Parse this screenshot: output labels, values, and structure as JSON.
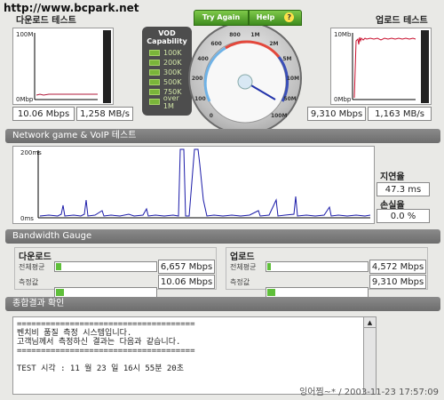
{
  "watermark_top": "http://www.bcpark.net",
  "download": {
    "title": "다운로드 테스트",
    "y_max": "100M",
    "y_min": "0Mbp",
    "speed_mbps": "10.06 Mbps",
    "speed_mbs": "1,258 MB/s"
  },
  "upload": {
    "title": "업로드 테스트",
    "y_max": "10Mb",
    "y_min": "0Mbp",
    "speed_mbps": "9,310 Mbps",
    "speed_mbs": "1,163 MB/s"
  },
  "vod": {
    "title": "VOD\nCapability",
    "items": [
      "100K",
      "200K",
      "300K",
      "500K",
      "750K",
      "over 1M"
    ]
  },
  "gauge": {
    "try_again": "Try Again",
    "help": "Help",
    "help_icon": "?",
    "ticks": [
      "0",
      "100",
      "200",
      "400",
      "600",
      "800",
      "1M",
      "2M",
      "5M",
      "10M",
      "50M",
      "100M"
    ]
  },
  "network": {
    "title": "Network game & VoIP 테스트",
    "y_max": "200ms",
    "y_min": "0ms",
    "latency_label": "지연율",
    "latency_value": "47.3 ms",
    "loss_label": "손실율",
    "loss_value": "0.0 %"
  },
  "bandwidth": {
    "title": "Bandwidth Gauge",
    "download_label": "다운로드",
    "upload_label": "업로드",
    "avg_label": "전체평균",
    "measured_label": "측정값",
    "dl_avg_value": "6,657 Mbps",
    "dl_measured_value": "10.06 Mbps",
    "ul_avg_value": "4,572 Mbps",
    "ul_measured_value": "9,310 Mbps",
    "dl_avg_fill": 0.07,
    "dl_measured_fill": 0.1,
    "ul_avg_fill": 0.05,
    "ul_measured_fill": 0.1
  },
  "summary": {
    "title": "종합결과 확인",
    "lines": [
      "=====================================",
      "벤치비 품질 측정 시스템입니다.",
      "고객님께서 측정하신 결과는 다음과 같습니다.",
      "=====================================",
      "",
      "TEST 시각 :           11 월 23 일   16시 55분 20초"
    ]
  },
  "watermark_bottom": "잉어찜~* / 2003-11-23 17:57:09",
  "colors": {
    "download_line": "#b01a3a",
    "upload_line": "#c8102e",
    "latency_line": "#1a1aa8",
    "bar_fill": "#5fbf3a"
  }
}
